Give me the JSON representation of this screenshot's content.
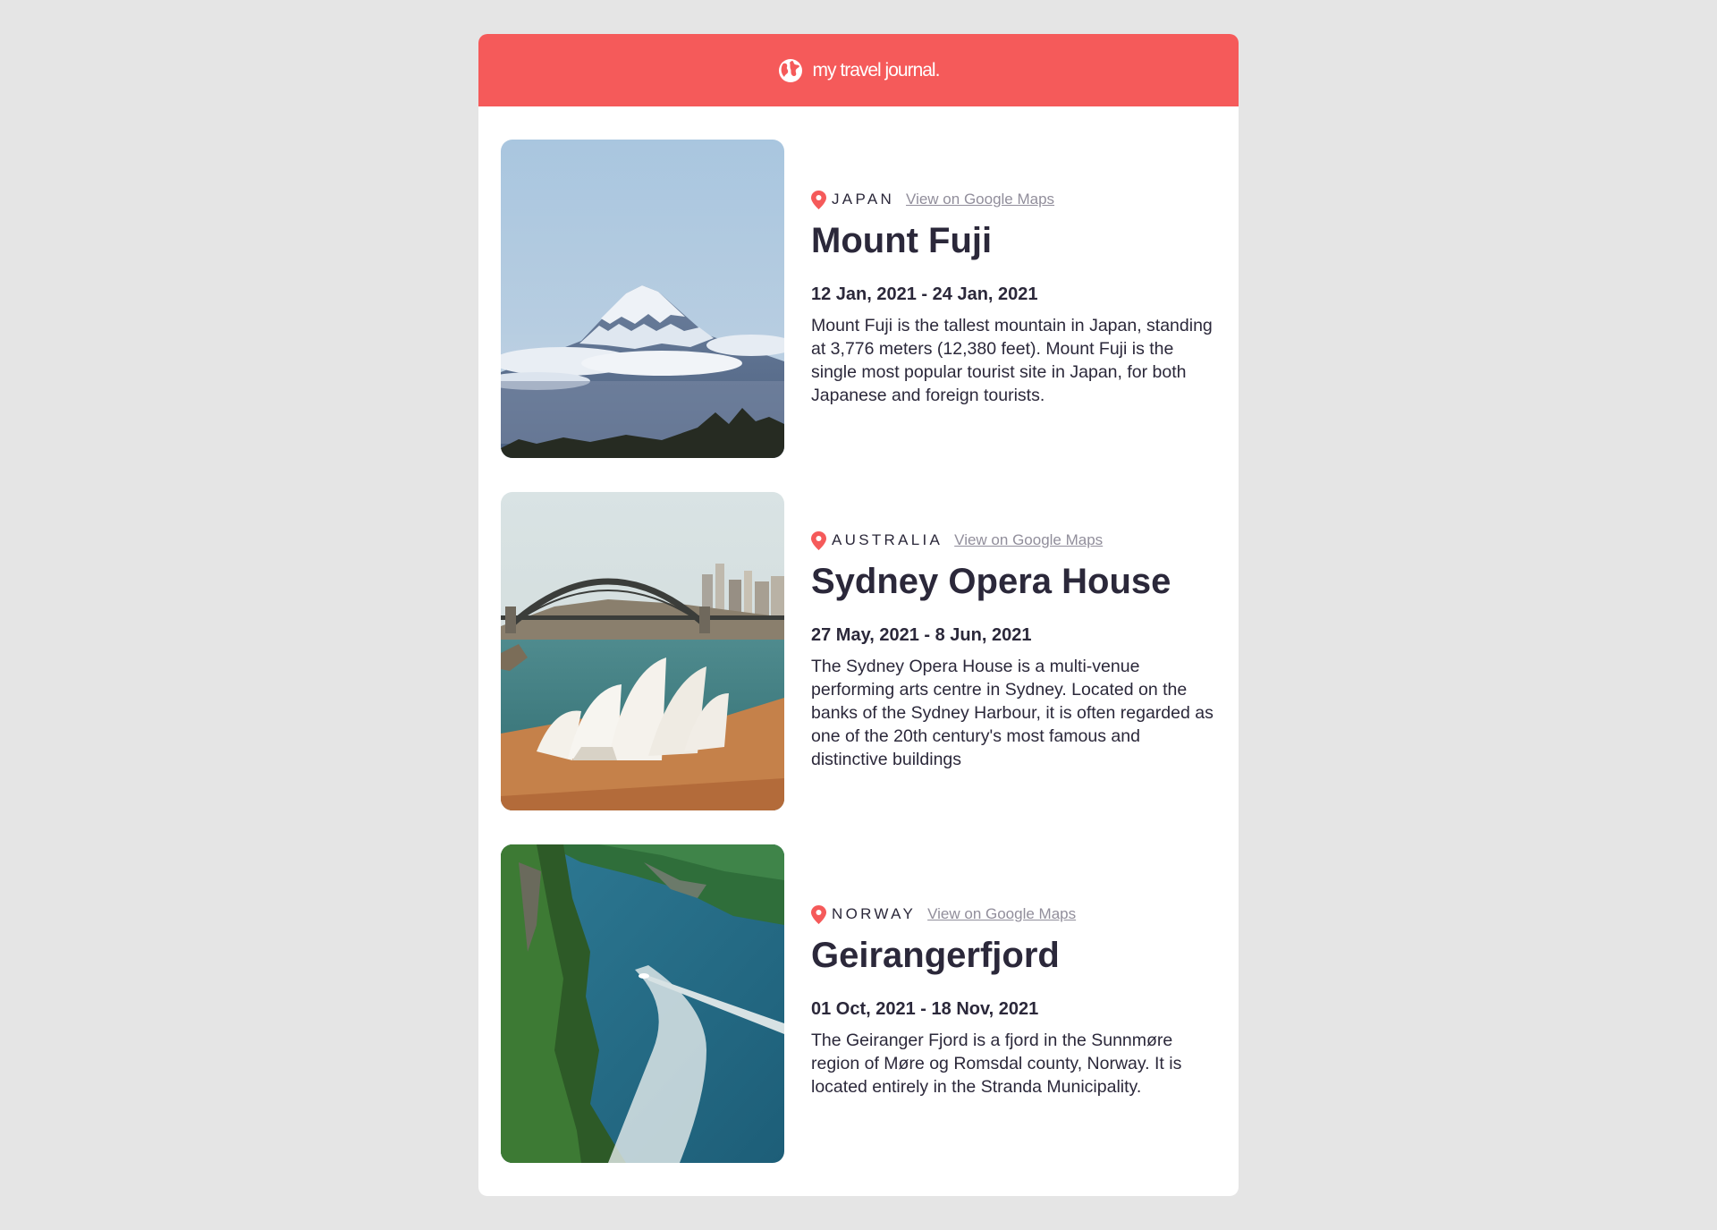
{
  "header": {
    "brand": "my travel journal.",
    "logo_icon": "globe-icon",
    "color": "#f55a5a"
  },
  "entries": [
    {
      "country": "JAPAN",
      "maps_label": "View on Google Maps",
      "title": "Mount Fuji",
      "dates": "12 Jan, 2021 - 24 Jan, 2021",
      "description": "Mount Fuji is the tallest mountain in Japan, standing at 3,776 meters (12,380 feet). Mount Fuji is the single most popular tourist site in Japan, for both Japanese and foreign tourists."
    },
    {
      "country": "AUSTRALIA",
      "maps_label": "View on Google Maps",
      "title": "Sydney Opera House",
      "dates": "27 May, 2021 - 8 Jun, 2021",
      "description": "The Sydney Opera House is a multi-venue performing arts centre in Sydney. Located on the banks of the Sydney Harbour, it is often regarded as one of the 20th century's most famous and distinctive buildings"
    },
    {
      "country": "NORWAY",
      "maps_label": "View on Google Maps",
      "title": "Geirangerfjord",
      "dates": "01 Oct, 2021 - 18 Nov, 2021",
      "description": "The Geiranger Fjord is a fjord in the Sunnmøre region of Møre og Romsdal county, Norway. It is located entirely in the Stranda Municipality."
    }
  ]
}
